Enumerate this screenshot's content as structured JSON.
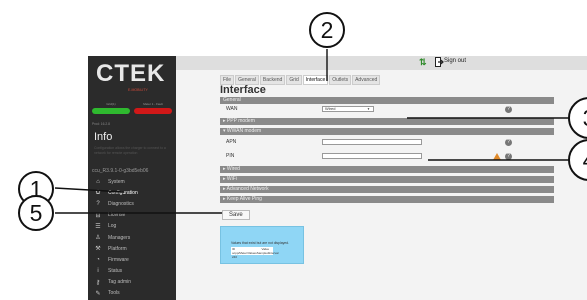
{
  "callouts": [
    "2",
    "3",
    "4",
    "1",
    "5"
  ],
  "app": {
    "logo": "CTEK",
    "logo_sub": "E-MOBILITY",
    "leds": [
      {
        "label": "Grid(1)",
        "color": "#2fb92f"
      },
      {
        "label": "Meter 1 - Fault",
        "color": "#d11818"
      }
    ],
    "version": "Prod: 16.2.8",
    "info_title": "Info",
    "info_desc": "Configuration allows the charger to connect to a network for remote operation",
    "station_id": "ccu_R3.9.1-0-g3bd5eb06",
    "menu": [
      {
        "label": "System",
        "icon": "home-icon"
      },
      {
        "label": "Configuration",
        "icon": "gear-icon"
      },
      {
        "label": "Diagnostics",
        "icon": "question-icon"
      },
      {
        "label": "License",
        "icon": "lock-icon"
      },
      {
        "label": "Log",
        "icon": "list-icon"
      },
      {
        "label": "Managers",
        "icon": "user-icon"
      },
      {
        "label": "Platform",
        "icon": "wrench-icon"
      },
      {
        "label": "Firmware",
        "icon": "wifi-icon"
      },
      {
        "label": "Status",
        "icon": "info-icon"
      },
      {
        "label": "Tag admin",
        "icon": "key-icon"
      },
      {
        "label": "Tools",
        "icon": "tools-icon"
      }
    ],
    "top": {
      "signout": "Sign out",
      "arrows": "⇅"
    },
    "tabs": [
      "File",
      "General",
      "Backend",
      "Grid",
      "Interface",
      "Outlets",
      "Advanced"
    ],
    "active_tab": "Interface",
    "page_title": "Interface",
    "general": {
      "header": "General",
      "wan_label": "WAN",
      "wan_value": "Wired"
    },
    "sections": {
      "ppp": "PPP modem",
      "wwan": "WWAN modem",
      "wired": "Wired",
      "wifi": "WiFi",
      "advanced": "Advanced Network",
      "keepalive": "Keep Alive Ping"
    },
    "wwan_fields": {
      "apn": "APN",
      "pin": "PIN"
    },
    "save": "Save",
    "note": {
      "text": "Values that exist but are not displayed.",
      "col_id": "ID",
      "col_value": "Value",
      "row": "ocpp/Meter/ValuesSampledInterval  240"
    }
  }
}
